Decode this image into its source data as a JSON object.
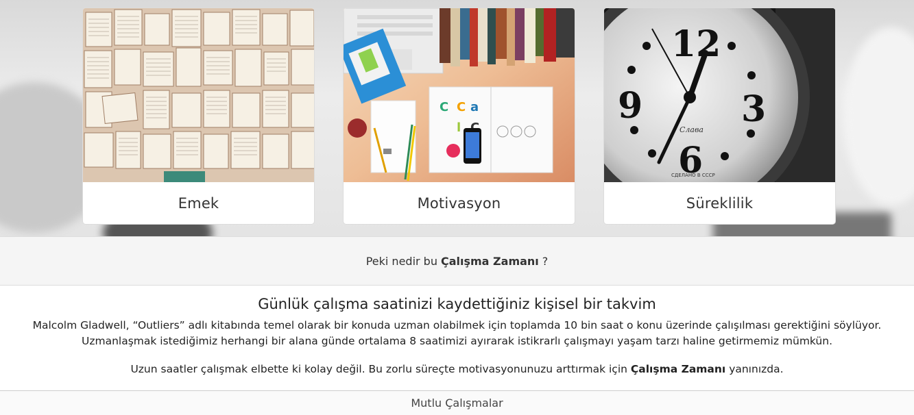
{
  "cards": [
    {
      "title": "Emek",
      "image": "open-books-image"
    },
    {
      "title": "Motivasyon",
      "image": "desk-workspace-image"
    },
    {
      "title": "Süreklilik",
      "image": "clock-image"
    }
  ],
  "intro": {
    "prefix": "Peki nedir bu",
    "brand": "Çalışma Zamanı",
    "suffix": "?"
  },
  "main": {
    "heading": "Günlük çalışma saatinizi kaydettiğiniz kişisel bir takvim",
    "paragraph1_line1": "Malcolm Gladwell, “Outliers” adlı kitabında temel olarak bir konuda uzman olabilmek için toplamda 10 bin saat o konu üzerinde çalışılması gerektiğini söylüyor.",
    "paragraph1_line2": "Uzmanlaşmak istediğimiz herhangi bir alana günde ortalama 8 saatimizi ayırarak istikrarlı çalışmayı yaşam tarzı haline getirmemiz mümkün.",
    "paragraph2_prefix": "Uzun saatler çalışmak elbette ki kolay değil. Bu zorlu süreçte motivasyonunuzu arttırmak için",
    "paragraph2_brand": "Çalışma Zamanı",
    "paragraph2_suffix": "yanınızda."
  },
  "footer": {
    "text": "Mutlu Çalışmalar"
  },
  "clock": {
    "numerals": [
      "12",
      "3",
      "6",
      "9"
    ],
    "brand": "Слава",
    "bottom": "СДЕЛАНО В СССР"
  }
}
